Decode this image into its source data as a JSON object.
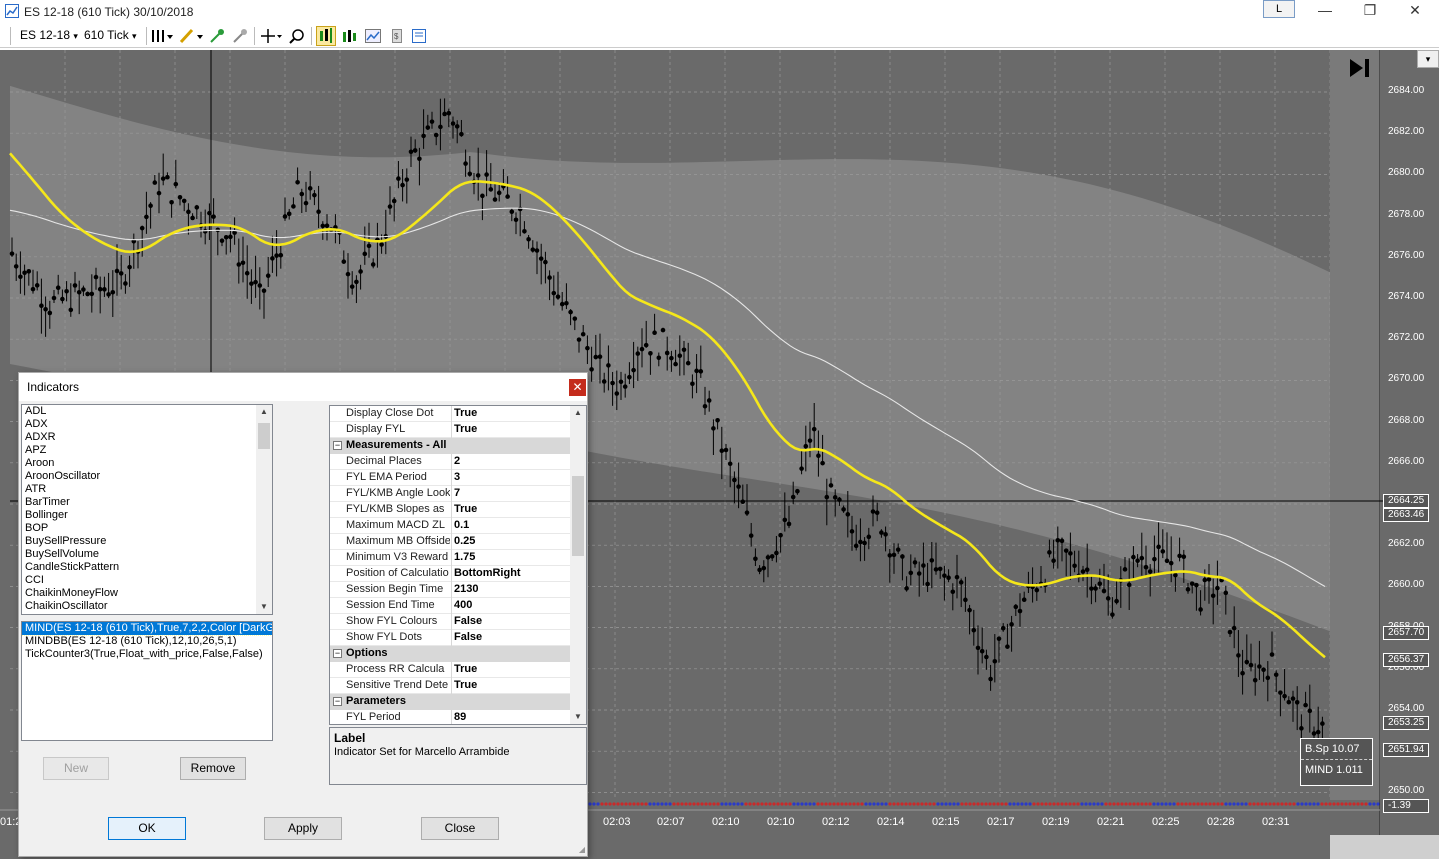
{
  "window": {
    "title": "ES 12-18 (610 Tick)  30/10/2018",
    "layout_button": "L",
    "minimize": "—",
    "restore": "❐",
    "close": "✕"
  },
  "toolbar": {
    "instrument": "ES 12-18",
    "interval": "610 Tick",
    "caret": "▾"
  },
  "chart": {
    "price_labels": [
      "2684.00",
      "2682.00",
      "2680.00",
      "2678.00",
      "2676.00",
      "2674.00",
      "2672.00",
      "2670.00",
      "2668.00",
      "2666.00",
      "2664.00",
      "2662.00",
      "2660.00",
      "2658.00",
      "2656.00",
      "2654.00",
      "2652.00",
      "2650.00"
    ],
    "price_boxes": {
      "b1": "2664.25",
      "b2": "2663.46",
      "b3": "2657.70",
      "b4": "2656.37",
      "b5": "2653.25",
      "b6": "2651.94",
      "b7": "-1.39"
    },
    "time_labels": [
      "01:2",
      "02:03",
      "02:07",
      "02:10",
      "02:10",
      "02:12",
      "02:14",
      "02:15",
      "02:17",
      "02:19",
      "02:21",
      "02:25",
      "02:28",
      "02:31"
    ],
    "info": {
      "line1": "B.Sp 10.07",
      "line2": "MIND 1.011"
    },
    "colors": {
      "background": "#6a6a6a",
      "band": "#8a8a8a",
      "ema": "#f5e71a",
      "mid": "#e6e6e6",
      "bar": "#000000"
    }
  },
  "dialog": {
    "title": "Indicators",
    "close": "✕",
    "available_indicators": [
      "ADL",
      "ADX",
      "ADXR",
      "APZ",
      "Aroon",
      "AroonOscillator",
      "ATR",
      "BarTimer",
      "Bollinger",
      "BOP",
      "BuySellPressure",
      "BuySellVolume",
      "CandleStickPattern",
      "CCI",
      "ChaikinMoneyFlow",
      "ChaikinOscillator"
    ],
    "applied_indicators": [
      "MIND(ES 12-18 (610 Tick),True,7,2,2,Color [DarkGr",
      "MINDBB(ES 12-18 (610 Tick),12,10,26,5,1)",
      "TickCounter3(True,Float_with_price,False,False)"
    ],
    "buttons": {
      "new": "New",
      "remove": "Remove",
      "ok": "OK",
      "apply": "Apply",
      "close": "Close"
    },
    "properties": [
      {
        "kind": "row",
        "name": "Display Close Dot",
        "value": "True"
      },
      {
        "kind": "row",
        "name": "Display FYL",
        "value": "True"
      },
      {
        "kind": "cat",
        "name": "Measurements - All"
      },
      {
        "kind": "row",
        "name": "Decimal Places",
        "value": "2"
      },
      {
        "kind": "row",
        "name": "FYL EMA Period",
        "value": "3"
      },
      {
        "kind": "row",
        "name": "FYL/KMB Angle Look",
        "value": "7"
      },
      {
        "kind": "row",
        "name": "FYL/KMB Slopes as",
        "value": "True"
      },
      {
        "kind": "row",
        "name": "Maximum MACD ZL",
        "value": "0.1"
      },
      {
        "kind": "row",
        "name": "Maximum MB Offside",
        "value": "0.25"
      },
      {
        "kind": "row",
        "name": "Minimum V3 Reward",
        "value": "1.75"
      },
      {
        "kind": "row",
        "name": "Position of Calculatio",
        "value": "BottomRight"
      },
      {
        "kind": "row",
        "name": "Session Begin Time",
        "value": "2130"
      },
      {
        "kind": "row",
        "name": "Session End Time",
        "value": "400"
      },
      {
        "kind": "row",
        "name": "Show FYL Colours",
        "value": "False"
      },
      {
        "kind": "row",
        "name": "Show FYL Dots",
        "value": "False"
      },
      {
        "kind": "cat",
        "name": "Options"
      },
      {
        "kind": "row",
        "name": "Process RR Calcula",
        "value": "True"
      },
      {
        "kind": "row",
        "name": "Sensitive Trend Dete",
        "value": "True"
      },
      {
        "kind": "cat",
        "name": "Parameters"
      },
      {
        "kind": "row",
        "name": "FYL Period",
        "value": "89"
      }
    ],
    "description": {
      "title": "Label",
      "text": "Indicator Set for Marcello Arrambide"
    }
  }
}
